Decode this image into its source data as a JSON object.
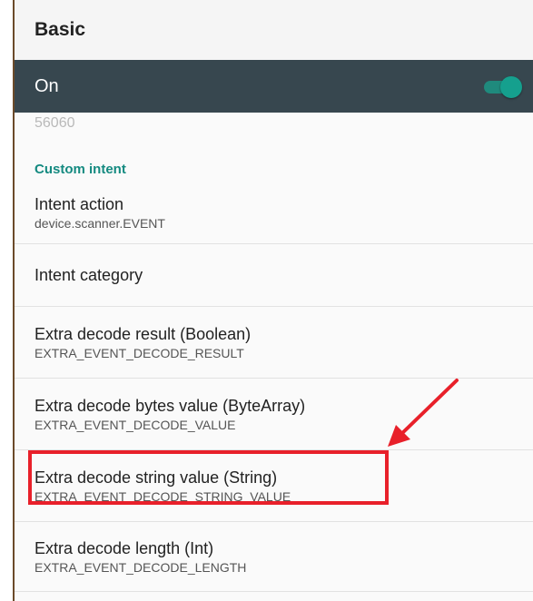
{
  "header": {
    "title": "Basic"
  },
  "master_switch": {
    "label": "On",
    "checked": true
  },
  "partial_value": "56060",
  "section": {
    "title": "Custom intent"
  },
  "prefs": [
    {
      "title": "Intent action",
      "summary": "device.scanner.EVENT"
    },
    {
      "title": "Intent category",
      "summary": ""
    },
    {
      "title": "Extra decode result (Boolean)",
      "summary": "EXTRA_EVENT_DECODE_RESULT"
    },
    {
      "title": "Extra decode bytes value (ByteArray)",
      "summary": "EXTRA_EVENT_DECODE_VALUE"
    },
    {
      "title": "Extra decode string value (String)",
      "summary": "EXTRA_EVENT_DECODE_STRING_VALUE"
    },
    {
      "title": "Extra decode length (Int)",
      "summary": "EXTRA_EVENT_DECODE_LENGTH"
    }
  ],
  "colors": {
    "bar": "#37474f",
    "accent": "#148a80",
    "annotation": "#e8202a"
  }
}
